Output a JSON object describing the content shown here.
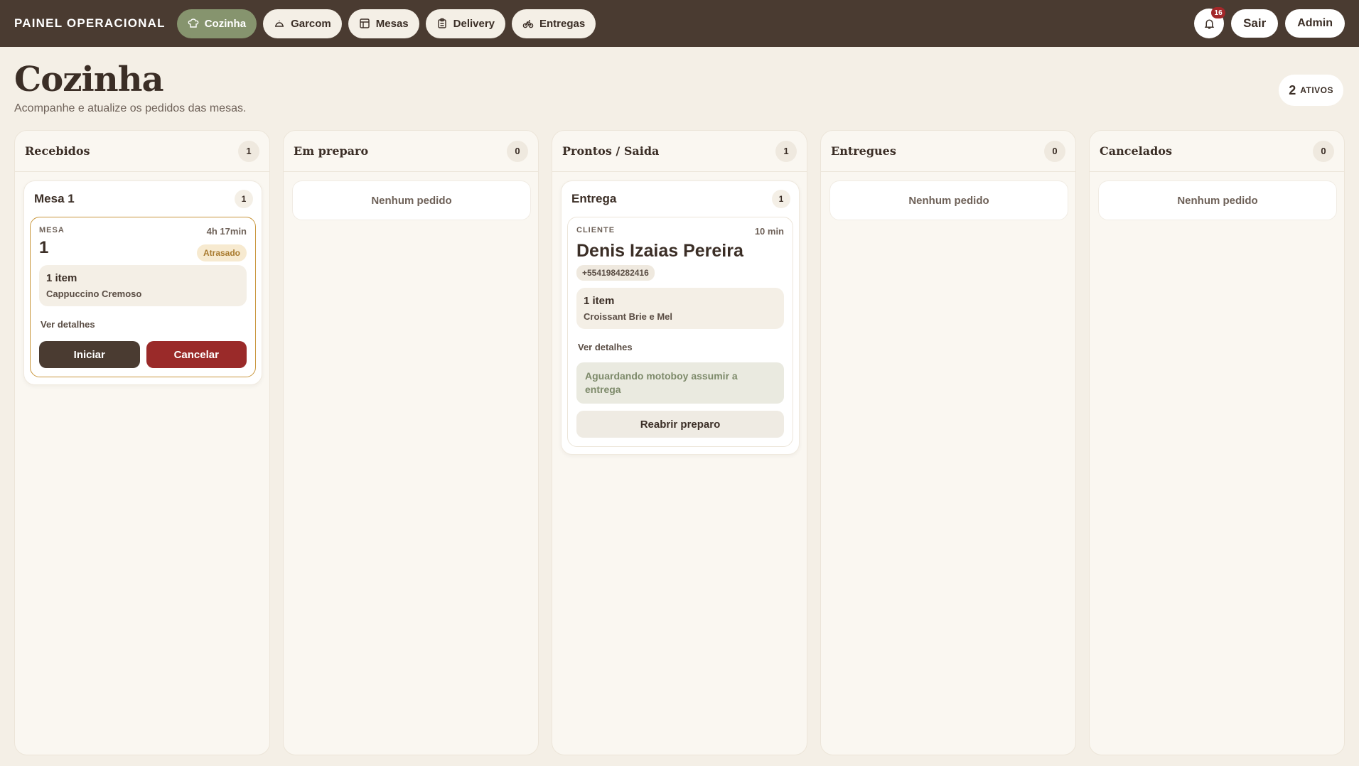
{
  "topbar": {
    "brand": "PAINEL OPERACIONAL",
    "nav": [
      {
        "label": "Cozinha",
        "icon": "chef-hat-icon",
        "active": true
      },
      {
        "label": "Garcom",
        "icon": "cloche-icon",
        "active": false
      },
      {
        "label": "Mesas",
        "icon": "table-grid-icon",
        "active": false
      },
      {
        "label": "Delivery",
        "icon": "clipboard-icon",
        "active": false
      },
      {
        "label": "Entregas",
        "icon": "bike-icon",
        "active": false
      }
    ],
    "notifications": "16",
    "logout_label": "Sair",
    "user_label": "Admin"
  },
  "header": {
    "title": "Cozinha",
    "subtitle": "Acompanhe e atualize os pedidos das mesas.",
    "active_count": "2",
    "active_label": "ATIVOS"
  },
  "columns": [
    {
      "title": "Recebidos",
      "count": "1"
    },
    {
      "title": "Em preparo",
      "count": "0",
      "empty": "Nenhum pedido"
    },
    {
      "title": "Prontos / Saida",
      "count": "1"
    },
    {
      "title": "Entregues",
      "count": "0",
      "empty": "Nenhum pedido"
    },
    {
      "title": "Cancelados",
      "count": "0",
      "empty": "Nenhum pedido"
    }
  ],
  "recebidos_group": {
    "title": "Mesa 1",
    "count": "1",
    "order": {
      "label": "MESA",
      "number": "1",
      "time": "4h 17min",
      "badge": "Atrasado",
      "items_count": "1 item",
      "items_name": "Cappuccino Cremoso",
      "details": "Ver detalhes",
      "start_label": "Iniciar",
      "cancel_label": "Cancelar"
    }
  },
  "prontos_group": {
    "title": "Entrega",
    "count": "1",
    "order": {
      "label": "CLIENTE",
      "name": "Denis Izaias Pereira",
      "time": "10 min",
      "phone": "+5541984282416",
      "items_count": "1 item",
      "items_name": "Croissant Brie e Mel",
      "details": "Ver detalhes",
      "waiting": "Aguardando motoboy assumir a entrega",
      "reopen_label": "Reabrir preparo"
    }
  },
  "colors": {
    "topbar": "#4a3b31",
    "active_nav": "#86946e",
    "late_border": "#c9973e",
    "cancel": "#9a2a29",
    "badge": "#a3282a"
  }
}
